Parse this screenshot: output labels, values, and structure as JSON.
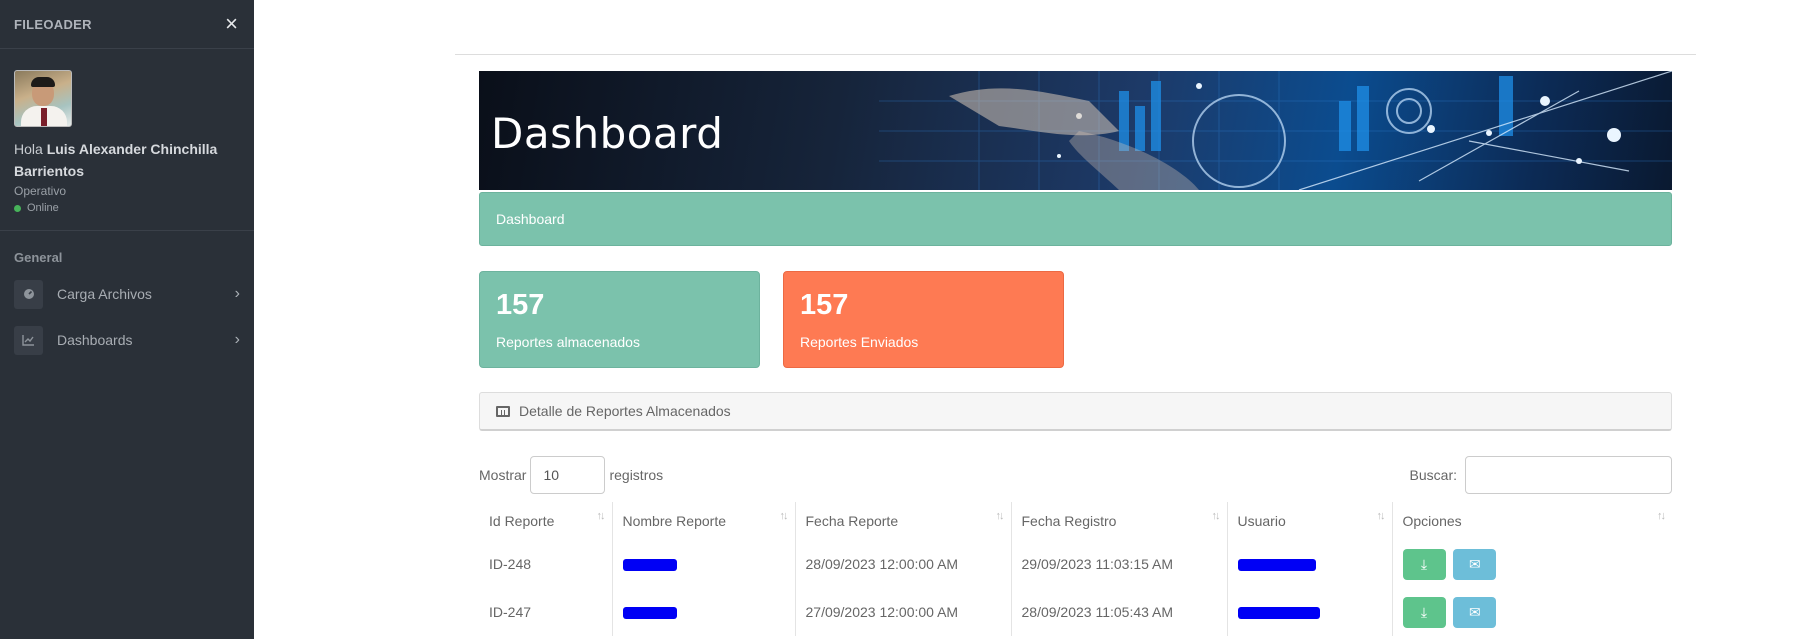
{
  "sidebar": {
    "brand": "FILEOADER",
    "close_icon": "×",
    "greeting_prefix": "Hola",
    "user_name": "Luis Alexander Chinchilla Barrientos",
    "role": "Operativo",
    "status": "Online",
    "section": "General",
    "items": [
      {
        "label": "Carga Archivos",
        "icon": "dashboard-gauge-icon"
      },
      {
        "label": "Dashboards",
        "icon": "line-chart-icon"
      }
    ],
    "chevron": "›"
  },
  "banner": {
    "title": "Dashboard"
  },
  "breadcrumb": {
    "label": "Dashboard"
  },
  "cards": [
    {
      "value": "157",
      "label": "Reportes almacenados",
      "color": "#7bc2ac"
    },
    {
      "value": "157",
      "label": "Reportes Enviados",
      "color": "#fe7a53"
    }
  ],
  "panel": {
    "title": "Detalle de Reportes Almacenados"
  },
  "controls": {
    "show_label": "Mostrar",
    "page_length": "10",
    "records_label": "registros",
    "search_label": "Buscar:",
    "search_value": ""
  },
  "table": {
    "headers": [
      "Id Reporte",
      "Nombre Reporte",
      "Fecha Reporte",
      "Fecha Registro",
      "Usuario",
      "Opciones"
    ],
    "sort_glyph": "↑↓",
    "rows": [
      {
        "id": "ID-248",
        "fecha_reporte": "28/09/2023 12:00:00 AM",
        "fecha_registro": "29/09/2023 11:03:15 AM"
      },
      {
        "id": "ID-247",
        "fecha_reporte": "27/09/2023 12:00:00 AM",
        "fecha_registro": "28/09/2023 11:05:43 AM"
      }
    ]
  },
  "icons": {
    "download": "⤓",
    "mail": "✉"
  }
}
